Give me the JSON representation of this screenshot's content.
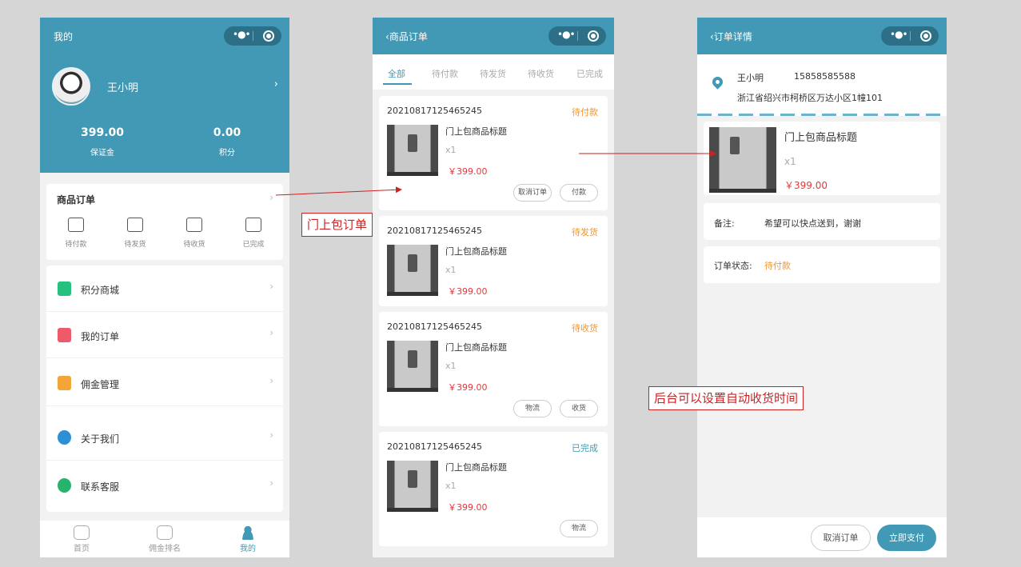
{
  "screen_profile": {
    "title": "我的",
    "username": "王小明",
    "stats": [
      {
        "value": "399.00",
        "label": "保证金"
      },
      {
        "value": "0.00",
        "label": "积分"
      }
    ],
    "orders_title": "商品订单",
    "order_icons": [
      "待付款",
      "待发货",
      "待收货",
      "已完成"
    ],
    "menu": [
      "积分商城",
      "我的订单",
      "佣金管理",
      "关于我们",
      "联系客服"
    ],
    "menu_icon_colors": [
      "#27c17f",
      "#ef5a6a",
      "#f3a537",
      "#2d8fd5",
      "#27b36c"
    ],
    "tabbar": [
      "首页",
      "佣金排名",
      "我的"
    ]
  },
  "screen_orders": {
    "title": "商品订单",
    "tabs": [
      "全部",
      "待付款",
      "待发货",
      "待收货",
      "已完成"
    ],
    "orders": [
      {
        "no": "20210817125465245",
        "status": "待付款",
        "status_color": "#f0962d",
        "title": "门上包商品标题",
        "qty": "x1",
        "price": "￥399.00",
        "buttons": [
          "取消订单",
          "付款"
        ]
      },
      {
        "no": "20210817125465245",
        "status": "待发货",
        "status_color": "#f0962d",
        "title": "门上包商品标题",
        "qty": "x1",
        "price": "￥399.00",
        "buttons": []
      },
      {
        "no": "20210817125465245",
        "status": "待收货",
        "status_color": "#f0962d",
        "title": "门上包商品标题",
        "qty": "x1",
        "price": "￥399.00",
        "buttons": [
          "物流",
          "收货"
        ]
      },
      {
        "no": "20210817125465245",
        "status": "已完成",
        "status_color": "#4299b5",
        "title": "门上包商品标题",
        "qty": "x1",
        "price": "￥399.00",
        "buttons": [
          "物流"
        ]
      }
    ]
  },
  "screen_detail": {
    "title": "订单详情",
    "name": "王小明",
    "phone": "15858585588",
    "address": "浙江省绍兴市柯桥区万达小区1幢101",
    "product_title": "门上包商品标题",
    "qty": "x1",
    "price": "￥399.00",
    "remark_label": "备注:",
    "remark": "希望可以快点送到，谢谢",
    "status_label": "订单状态:",
    "status": "待付款",
    "cancel_btn": "取消订单",
    "pay_btn": "立即支付"
  },
  "annotations": {
    "note1": "门上包订单",
    "note2": "后台可以设置自动收货时间"
  },
  "colors": {
    "primary": "#4299b5",
    "price": "#e4393c",
    "pending": "#f0962d",
    "annotation": "#cc2222"
  }
}
